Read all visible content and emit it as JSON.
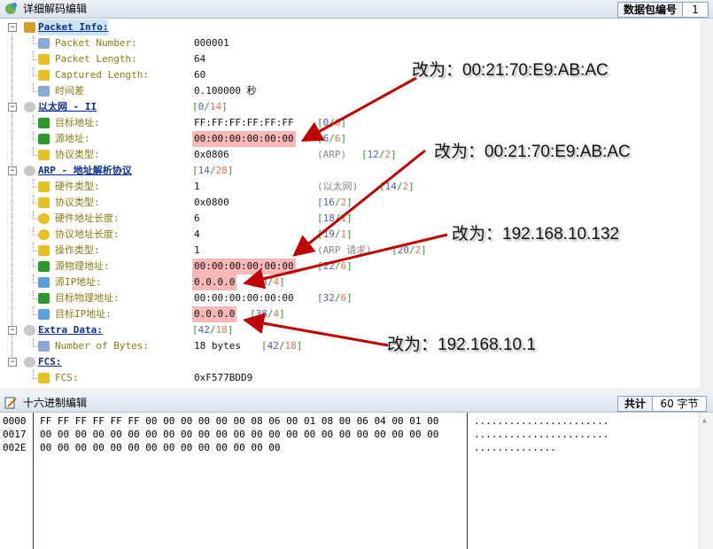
{
  "decode_panel": {
    "title": "详细解码编辑",
    "packet_no_label": "数据包编号",
    "packet_no": "1"
  },
  "tree": [
    {
      "level": 0,
      "icon": "network-node-icon",
      "label": "Packet Info:",
      "sel": true
    },
    {
      "level": 1,
      "icon": "document-icon",
      "label": "Packet Number:",
      "value": "000001"
    },
    {
      "level": 1,
      "icon": "field-icon",
      "label": "Packet Length:",
      "value": "64"
    },
    {
      "level": 1,
      "icon": "field-icon",
      "label": "Captured Length:",
      "value": "60"
    },
    {
      "level": 1,
      "icon": "document-icon",
      "label": "时间差",
      "value": "0.100000 秒"
    },
    {
      "level": 0,
      "icon": "protocol-icon",
      "label": "以太网 - II",
      "range": [
        "0",
        "14"
      ],
      "rx": 217
    },
    {
      "level": 1,
      "icon": "mac-address-icon",
      "label": "目标地址:",
      "value": "FF:FF:FF:FF:FF:FF",
      "range": [
        "0",
        "6"
      ],
      "rx": 358
    },
    {
      "level": 1,
      "icon": "mac-address-icon",
      "label": "源地址:",
      "value": "00:00:00:00:00:00",
      "hl": true,
      "range": [
        "6",
        "6"
      ],
      "rx": 358
    },
    {
      "level": 1,
      "icon": "field-icon",
      "label": "协议类型:",
      "value": "0x0806",
      "extra": "(ARP)",
      "range": [
        "12",
        "2"
      ],
      "rx": 408
    },
    {
      "level": 0,
      "icon": "protocol-icon",
      "label": "ARP - 地址解析协议",
      "range": [
        "14",
        "28"
      ],
      "rx": 217
    },
    {
      "level": 1,
      "icon": "field-icon",
      "label": "硬件类型:",
      "value": "1",
      "extra": "(以太网)",
      "range": [
        "14",
        "2"
      ],
      "rx": 428
    },
    {
      "level": 1,
      "icon": "field-icon",
      "label": "协议类型:",
      "value": "0x0800",
      "range": [
        "16",
        "2"
      ],
      "rx": 358
    },
    {
      "level": 1,
      "icon": "byte-icon",
      "label": "硬件地址长度:",
      "value": "6",
      "range": [
        "18",
        "1"
      ],
      "rx": 358
    },
    {
      "level": 1,
      "icon": "byte-icon",
      "label": "协议地址长度:",
      "value": "4",
      "range": [
        "19",
        "1"
      ],
      "rx": 358
    },
    {
      "level": 1,
      "icon": "field-icon",
      "label": "操作类型:",
      "value": "1",
      "extra": "(ARP 请求)",
      "range": [
        "20",
        "2"
      ],
      "rx": 442
    },
    {
      "level": 1,
      "icon": "mac-address-icon",
      "label": "源物理地址:",
      "value": "00:00:00:00:00:00",
      "hl": true,
      "range": [
        "22",
        "6"
      ],
      "rx": 358
    },
    {
      "level": 1,
      "icon": "computer-icon",
      "label": "源IP地址:",
      "value": "0.0.0.0",
      "hl": true,
      "range": [
        "28",
        "4"
      ],
      "rx": 282
    },
    {
      "level": 1,
      "icon": "mac-address-icon",
      "label": "目标物理地址:",
      "value": "00:00:00:00:00:00",
      "range": [
        "32",
        "6"
      ],
      "rx": 358
    },
    {
      "level": 1,
      "icon": "computer-icon",
      "label": "目标IP地址:",
      "value": "0.0.0.0",
      "hl": true,
      "range": [
        "38",
        "4"
      ],
      "rx": 282
    },
    {
      "level": 0,
      "icon": "protocol-icon",
      "label": "Extra Data:",
      "range": [
        "42",
        "18"
      ],
      "rx": 217
    },
    {
      "level": 1,
      "icon": "document-icon",
      "label": "Number of Bytes:",
      "value": "18 bytes",
      "range": [
        "42",
        "18"
      ],
      "rx": 295
    },
    {
      "level": 0,
      "icon": "protocol-icon",
      "label": "FCS:"
    },
    {
      "level": 1,
      "icon": "stack-icon",
      "label": "FCS:",
      "value": "0xF577BDD9"
    }
  ],
  "hex_panel": {
    "title": "十六进制编辑",
    "total_label": "共计",
    "total": "60 字节",
    "rows": [
      {
        "offset": "0000",
        "bytes": "FF FF FF FF FF FF 00 00 00 00 00 00 08 06 00 01 08 00 06 04 00 01 00",
        "ascii": "......................."
      },
      {
        "offset": "0017",
        "bytes": "00 00 00 00 00 00 00 00 00 00 00 00 00 00 00 00 00 00 00 00 00 00 00",
        "ascii": "......................."
      },
      {
        "offset": "002E",
        "bytes": "00 00 00 00 00 00 00 00 00 00 00 00 00 00",
        "ascii": ".............."
      }
    ]
  },
  "annotations": [
    "改为：00:21:70:E9:AB:AC",
    "改为：00:21:70:E9:AB:AC",
    "改为：192.168.10.132",
    "改为：192.168.10.1"
  ],
  "colors": {
    "highlight": "#f8b8b8",
    "arrow": "#c00000",
    "label": "#8b7a10",
    "header_label": "#0b2f94"
  }
}
